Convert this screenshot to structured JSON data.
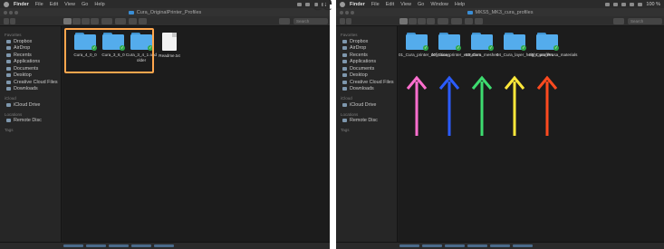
{
  "left": {
    "menubar": {
      "app": "Finder",
      "items": [
        "File",
        "Edit",
        "View",
        "Go",
        "Help"
      ]
    },
    "window_title": "Cura_OriginalPrinter_Profiles",
    "search_placeholder": "Search",
    "sidebar": {
      "favorites_label": "Favorites",
      "favorites": [
        "Dropbox",
        "AirDrop",
        "Recents",
        "Applications",
        "Documents",
        "Desktop",
        "Creative Cloud Files",
        "Downloads"
      ],
      "icloud_label": "iCloud",
      "icloud": [
        "iCloud Drive"
      ],
      "locations_label": "Locations",
      "locations": [
        "Remote Disc"
      ],
      "tags_label": "Tags"
    },
    "files": [
      "Cura_4_0_0",
      "Cura_3_6_0",
      "Cura_3_4_1 and older",
      "Readme.txt"
    ]
  },
  "right": {
    "menubar": {
      "app": "Finder",
      "items": [
        "File",
        "Edit",
        "View",
        "Go",
        "Window",
        "Help"
      ],
      "battery": "100 %"
    },
    "window_title": "MKS5_MK3_cura_profiles",
    "search_placeholder": "Search",
    "sidebar": {
      "favorites_label": "Favorites",
      "favorites": [
        "Dropbox",
        "AirDrop",
        "Recents",
        "Applications",
        "Documents",
        "Desktop",
        "Creative Cloud Files",
        "Downloads"
      ],
      "icloud_label": "iCloud",
      "icloud": [
        "iCloud Drive"
      ],
      "locations_label": "Locations",
      "locations": [
        "Remote Disc"
      ],
      "tags_label": "Tags"
    },
    "files": [
      "01_Cura_printer_definitions",
      "02_Cura_printer_extruders",
      "03_Cura_meshes",
      "04_Cura_layer_height_profiles",
      "05_Cura_Prusa_materials"
    ],
    "arrow_colors": [
      "#ff6fcf",
      "#2b5cff",
      "#3ddc6f",
      "#ffe83a",
      "#ff4a1f"
    ]
  },
  "overlay_text": "ce"
}
